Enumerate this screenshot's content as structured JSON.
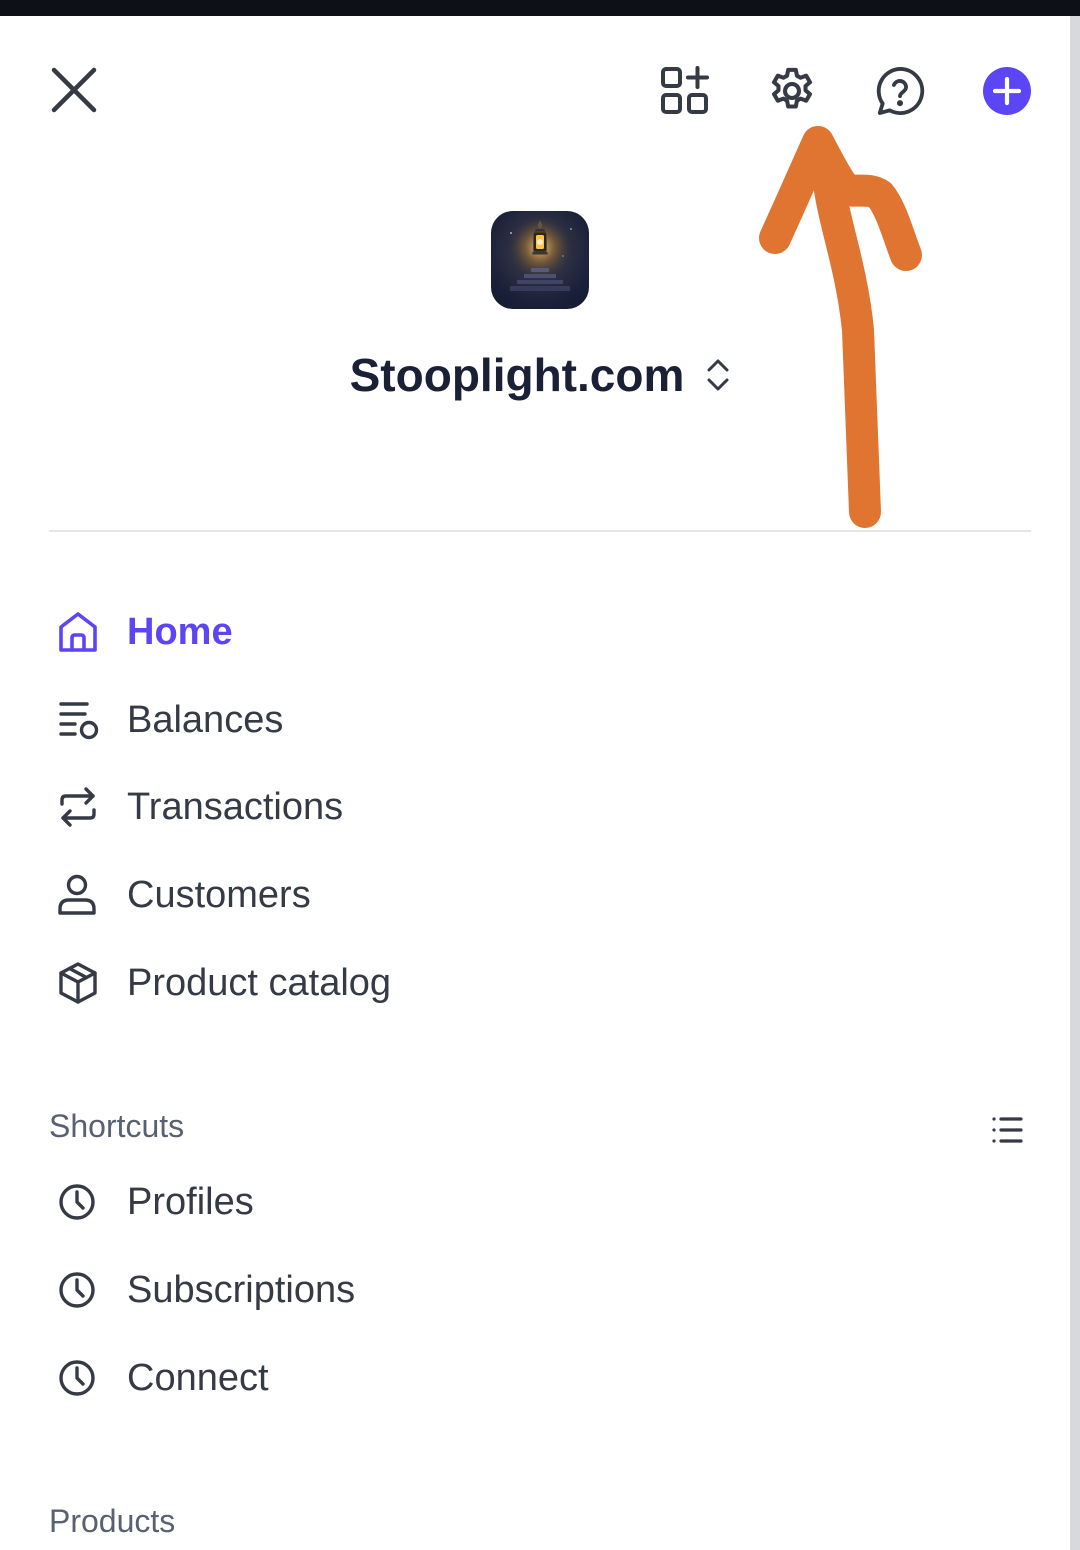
{
  "brand": {
    "name": "Stooplight.com"
  },
  "toolbar": {
    "accent_color": "#5b45f5"
  },
  "nav": {
    "items": [
      {
        "label": "Home",
        "icon": "home-icon",
        "active": true
      },
      {
        "label": "Balances",
        "icon": "balances-icon",
        "active": false
      },
      {
        "label": "Transactions",
        "icon": "transactions-icon",
        "active": false
      },
      {
        "label": "Customers",
        "icon": "customer-icon",
        "active": false
      },
      {
        "label": "Product catalog",
        "icon": "box-icon",
        "active": false
      }
    ]
  },
  "shortcuts": {
    "header": "Shortcuts",
    "items": [
      {
        "label": "Profiles",
        "icon": "clock-icon"
      },
      {
        "label": "Subscriptions",
        "icon": "clock-icon"
      },
      {
        "label": "Connect",
        "icon": "clock-icon"
      }
    ]
  },
  "products": {
    "header": "Products"
  },
  "annotation": {
    "color": "#e07532",
    "shape": "arrow-pointing-to-gear-icon"
  }
}
